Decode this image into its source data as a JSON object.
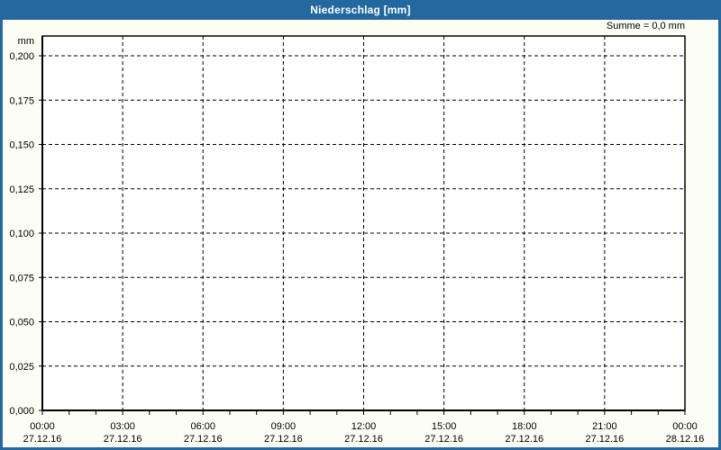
{
  "window": {
    "title": "Niederschlag [mm]"
  },
  "colors": {
    "title_bar": "#2369A0",
    "title_text": "#FFFFFF",
    "window_border": "#2369A0",
    "content_background": "#FCFDF5",
    "plot_background": "#FFFFFF",
    "axis": "#000000",
    "grid": "#000000",
    "label_text": "#000000"
  },
  "chart_data": {
    "type": "line",
    "title": "Niederschlag [mm]",
    "ylabel": "mm",
    "summary": "Summe = 0,0 mm",
    "sum_mm": "0,0",
    "ylim": [
      0,
      0.2
    ],
    "y_tick_values": [
      0,
      0.025,
      0.05,
      0.075,
      0.1,
      0.125,
      0.15,
      0.175,
      0.2
    ],
    "y_tick_labels": [
      "0,000",
      "0,025",
      "0,050",
      "0,075",
      "0,100",
      "0,125",
      "0,150",
      "0,175",
      "0,200"
    ],
    "x_axis": {
      "hours_span": 24,
      "major_tick_hours": [
        0,
        3,
        6,
        9,
        12,
        15,
        18,
        21,
        24
      ],
      "minor_tick_every_hours": 1,
      "tick_labels": [
        {
          "time": "00:00",
          "date": "27.12.16"
        },
        {
          "time": "03:00",
          "date": "27.12.16"
        },
        {
          "time": "06:00",
          "date": "27.12.16"
        },
        {
          "time": "09:00",
          "date": "27.12.16"
        },
        {
          "time": "12:00",
          "date": "27.12.16"
        },
        {
          "time": "15:00",
          "date": "27.12.16"
        },
        {
          "time": "18:00",
          "date": "27.12.16"
        },
        {
          "time": "21:00",
          "date": "27.12.16"
        },
        {
          "time": "00:00",
          "date": "28.12.16"
        }
      ]
    },
    "grid": true,
    "legend": false,
    "series": [
      {
        "name": "Niederschlag",
        "values": []
      }
    ]
  }
}
